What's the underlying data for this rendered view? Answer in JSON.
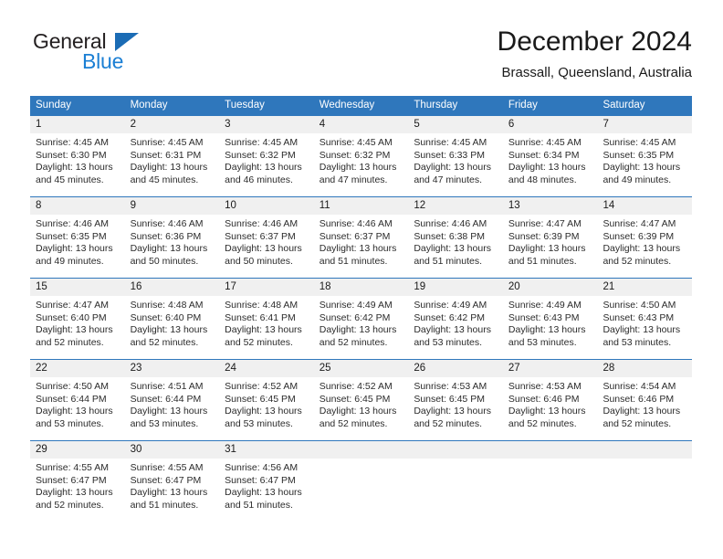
{
  "brand": {
    "name_top": "General",
    "name_bottom": "Blue",
    "triangle_color": "#1b6cb5",
    "blue_color": "#1b7fd4"
  },
  "header": {
    "month_title": "December 2024",
    "location": "Brassall, Queensland, Australia"
  },
  "theme": {
    "header_bar": "#2f77bc",
    "day_band": "#f0f0f0",
    "text": "#1a1a1a"
  },
  "weekdays": [
    "Sunday",
    "Monday",
    "Tuesday",
    "Wednesday",
    "Thursday",
    "Friday",
    "Saturday"
  ],
  "weeks": [
    [
      {
        "date": "1",
        "sunrise": "Sunrise: 4:45 AM",
        "sunset": "Sunset: 6:30 PM",
        "daylight_1": "Daylight: 13 hours",
        "daylight_2": "and 45 minutes."
      },
      {
        "date": "2",
        "sunrise": "Sunrise: 4:45 AM",
        "sunset": "Sunset: 6:31 PM",
        "daylight_1": "Daylight: 13 hours",
        "daylight_2": "and 45 minutes."
      },
      {
        "date": "3",
        "sunrise": "Sunrise: 4:45 AM",
        "sunset": "Sunset: 6:32 PM",
        "daylight_1": "Daylight: 13 hours",
        "daylight_2": "and 46 minutes."
      },
      {
        "date": "4",
        "sunrise": "Sunrise: 4:45 AM",
        "sunset": "Sunset: 6:32 PM",
        "daylight_1": "Daylight: 13 hours",
        "daylight_2": "and 47 minutes."
      },
      {
        "date": "5",
        "sunrise": "Sunrise: 4:45 AM",
        "sunset": "Sunset: 6:33 PM",
        "daylight_1": "Daylight: 13 hours",
        "daylight_2": "and 47 minutes."
      },
      {
        "date": "6",
        "sunrise": "Sunrise: 4:45 AM",
        "sunset": "Sunset: 6:34 PM",
        "daylight_1": "Daylight: 13 hours",
        "daylight_2": "and 48 minutes."
      },
      {
        "date": "7",
        "sunrise": "Sunrise: 4:45 AM",
        "sunset": "Sunset: 6:35 PM",
        "daylight_1": "Daylight: 13 hours",
        "daylight_2": "and 49 minutes."
      }
    ],
    [
      {
        "date": "8",
        "sunrise": "Sunrise: 4:46 AM",
        "sunset": "Sunset: 6:35 PM",
        "daylight_1": "Daylight: 13 hours",
        "daylight_2": "and 49 minutes."
      },
      {
        "date": "9",
        "sunrise": "Sunrise: 4:46 AM",
        "sunset": "Sunset: 6:36 PM",
        "daylight_1": "Daylight: 13 hours",
        "daylight_2": "and 50 minutes."
      },
      {
        "date": "10",
        "sunrise": "Sunrise: 4:46 AM",
        "sunset": "Sunset: 6:37 PM",
        "daylight_1": "Daylight: 13 hours",
        "daylight_2": "and 50 minutes."
      },
      {
        "date": "11",
        "sunrise": "Sunrise: 4:46 AM",
        "sunset": "Sunset: 6:37 PM",
        "daylight_1": "Daylight: 13 hours",
        "daylight_2": "and 51 minutes."
      },
      {
        "date": "12",
        "sunrise": "Sunrise: 4:46 AM",
        "sunset": "Sunset: 6:38 PM",
        "daylight_1": "Daylight: 13 hours",
        "daylight_2": "and 51 minutes."
      },
      {
        "date": "13",
        "sunrise": "Sunrise: 4:47 AM",
        "sunset": "Sunset: 6:39 PM",
        "daylight_1": "Daylight: 13 hours",
        "daylight_2": "and 51 minutes."
      },
      {
        "date": "14",
        "sunrise": "Sunrise: 4:47 AM",
        "sunset": "Sunset: 6:39 PM",
        "daylight_1": "Daylight: 13 hours",
        "daylight_2": "and 52 minutes."
      }
    ],
    [
      {
        "date": "15",
        "sunrise": "Sunrise: 4:47 AM",
        "sunset": "Sunset: 6:40 PM",
        "daylight_1": "Daylight: 13 hours",
        "daylight_2": "and 52 minutes."
      },
      {
        "date": "16",
        "sunrise": "Sunrise: 4:48 AM",
        "sunset": "Sunset: 6:40 PM",
        "daylight_1": "Daylight: 13 hours",
        "daylight_2": "and 52 minutes."
      },
      {
        "date": "17",
        "sunrise": "Sunrise: 4:48 AM",
        "sunset": "Sunset: 6:41 PM",
        "daylight_1": "Daylight: 13 hours",
        "daylight_2": "and 52 minutes."
      },
      {
        "date": "18",
        "sunrise": "Sunrise: 4:49 AM",
        "sunset": "Sunset: 6:42 PM",
        "daylight_1": "Daylight: 13 hours",
        "daylight_2": "and 52 minutes."
      },
      {
        "date": "19",
        "sunrise": "Sunrise: 4:49 AM",
        "sunset": "Sunset: 6:42 PM",
        "daylight_1": "Daylight: 13 hours",
        "daylight_2": "and 53 minutes."
      },
      {
        "date": "20",
        "sunrise": "Sunrise: 4:49 AM",
        "sunset": "Sunset: 6:43 PM",
        "daylight_1": "Daylight: 13 hours",
        "daylight_2": "and 53 minutes."
      },
      {
        "date": "21",
        "sunrise": "Sunrise: 4:50 AM",
        "sunset": "Sunset: 6:43 PM",
        "daylight_1": "Daylight: 13 hours",
        "daylight_2": "and 53 minutes."
      }
    ],
    [
      {
        "date": "22",
        "sunrise": "Sunrise: 4:50 AM",
        "sunset": "Sunset: 6:44 PM",
        "daylight_1": "Daylight: 13 hours",
        "daylight_2": "and 53 minutes."
      },
      {
        "date": "23",
        "sunrise": "Sunrise: 4:51 AM",
        "sunset": "Sunset: 6:44 PM",
        "daylight_1": "Daylight: 13 hours",
        "daylight_2": "and 53 minutes."
      },
      {
        "date": "24",
        "sunrise": "Sunrise: 4:52 AM",
        "sunset": "Sunset: 6:45 PM",
        "daylight_1": "Daylight: 13 hours",
        "daylight_2": "and 53 minutes."
      },
      {
        "date": "25",
        "sunrise": "Sunrise: 4:52 AM",
        "sunset": "Sunset: 6:45 PM",
        "daylight_1": "Daylight: 13 hours",
        "daylight_2": "and 52 minutes."
      },
      {
        "date": "26",
        "sunrise": "Sunrise: 4:53 AM",
        "sunset": "Sunset: 6:45 PM",
        "daylight_1": "Daylight: 13 hours",
        "daylight_2": "and 52 minutes."
      },
      {
        "date": "27",
        "sunrise": "Sunrise: 4:53 AM",
        "sunset": "Sunset: 6:46 PM",
        "daylight_1": "Daylight: 13 hours",
        "daylight_2": "and 52 minutes."
      },
      {
        "date": "28",
        "sunrise": "Sunrise: 4:54 AM",
        "sunset": "Sunset: 6:46 PM",
        "daylight_1": "Daylight: 13 hours",
        "daylight_2": "and 52 minutes."
      }
    ],
    [
      {
        "date": "29",
        "sunrise": "Sunrise: 4:55 AM",
        "sunset": "Sunset: 6:47 PM",
        "daylight_1": "Daylight: 13 hours",
        "daylight_2": "and 52 minutes."
      },
      {
        "date": "30",
        "sunrise": "Sunrise: 4:55 AM",
        "sunset": "Sunset: 6:47 PM",
        "daylight_1": "Daylight: 13 hours",
        "daylight_2": "and 51 minutes."
      },
      {
        "date": "31",
        "sunrise": "Sunrise: 4:56 AM",
        "sunset": "Sunset: 6:47 PM",
        "daylight_1": "Daylight: 13 hours",
        "daylight_2": "and 51 minutes."
      },
      {
        "date": "",
        "sunrise": "",
        "sunset": "",
        "daylight_1": "",
        "daylight_2": ""
      },
      {
        "date": "",
        "sunrise": "",
        "sunset": "",
        "daylight_1": "",
        "daylight_2": ""
      },
      {
        "date": "",
        "sunrise": "",
        "sunset": "",
        "daylight_1": "",
        "daylight_2": ""
      },
      {
        "date": "",
        "sunrise": "",
        "sunset": "",
        "daylight_1": "",
        "daylight_2": ""
      }
    ]
  ]
}
